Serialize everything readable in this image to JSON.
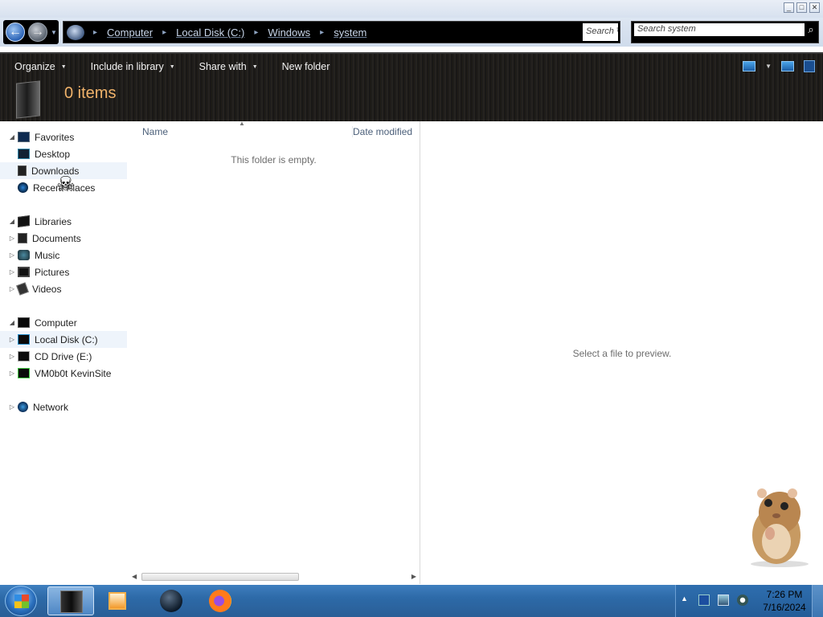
{
  "window": {
    "controls": {
      "minimize": "_",
      "maximize": "□",
      "close": "✕"
    }
  },
  "address_bar": {
    "breadcrumbs": [
      "Computer",
      "Local Disk (C:)",
      "Windows",
      "system"
    ],
    "separator": "▸",
    "search_hint": "Search",
    "search_arrow": "↻"
  },
  "search": {
    "placeholder": "Search system",
    "icon": "search-icon"
  },
  "toolbar": {
    "organize": "Organize",
    "include_in_library": "Include in library",
    "share_with": "Share with",
    "new_folder": "New folder"
  },
  "details": {
    "item_count": "0 items"
  },
  "nav": {
    "favorites": {
      "label": "Favorites",
      "items": [
        "Desktop",
        "Downloads",
        "Recent Places"
      ]
    },
    "libraries": {
      "label": "Libraries",
      "items": [
        "Documents",
        "Music",
        "Pictures",
        "Videos"
      ]
    },
    "computer": {
      "label": "Computer",
      "items": [
        "Local Disk (C:)",
        "CD Drive (E:)",
        "VM0b0t KevinSite"
      ]
    },
    "network": {
      "label": "Network"
    }
  },
  "file_list": {
    "columns": [
      "Name",
      "Date modified"
    ],
    "empty_message": "This folder is empty."
  },
  "preview": {
    "message": "Select a file to preview."
  },
  "taskbar": {
    "clock_time": "7:26 PM",
    "clock_date": "7/16/2024"
  },
  "colors": {
    "accent": "#f0b26a",
    "taskbar": "#2d6aa8",
    "toolbar": "#1a1a1a"
  }
}
